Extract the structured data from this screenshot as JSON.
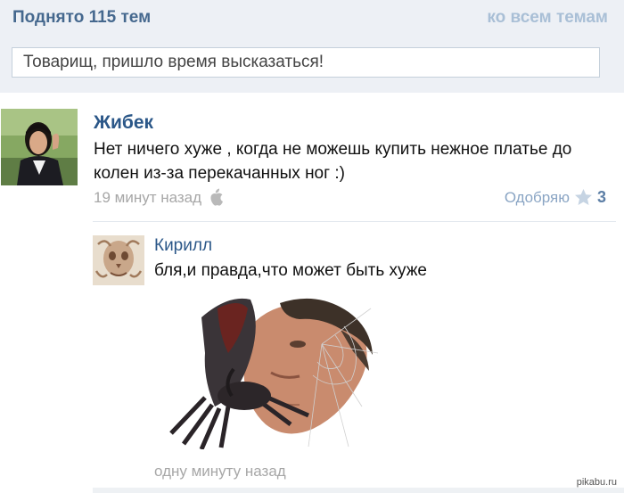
{
  "header": {
    "title": "Поднято 115 тем",
    "all_topics_link": "ко всем темам"
  },
  "composer": {
    "placeholder": "Товарищ, пришло время высказаться!"
  },
  "post": {
    "author": "Жибек",
    "text": "Нет ничего хуже , когда не можешь купить нежное платье до колен из-за перекачанных ног :)",
    "time": "19 минут назад",
    "device_icon": "apple-icon",
    "like_label": "Одобряю",
    "like_icon": "star-icon",
    "like_count": "3"
  },
  "reply": {
    "author": "Кирилл",
    "text": "бля,и правда,что может быть хуже",
    "time": "одну минуту назад"
  },
  "watermark": "pikabu.ru",
  "colors": {
    "header_bg": "#edf0f5",
    "link_blue": "#2b5788",
    "header_title": "#45688e",
    "muted_gray": "#a7a7a7"
  }
}
